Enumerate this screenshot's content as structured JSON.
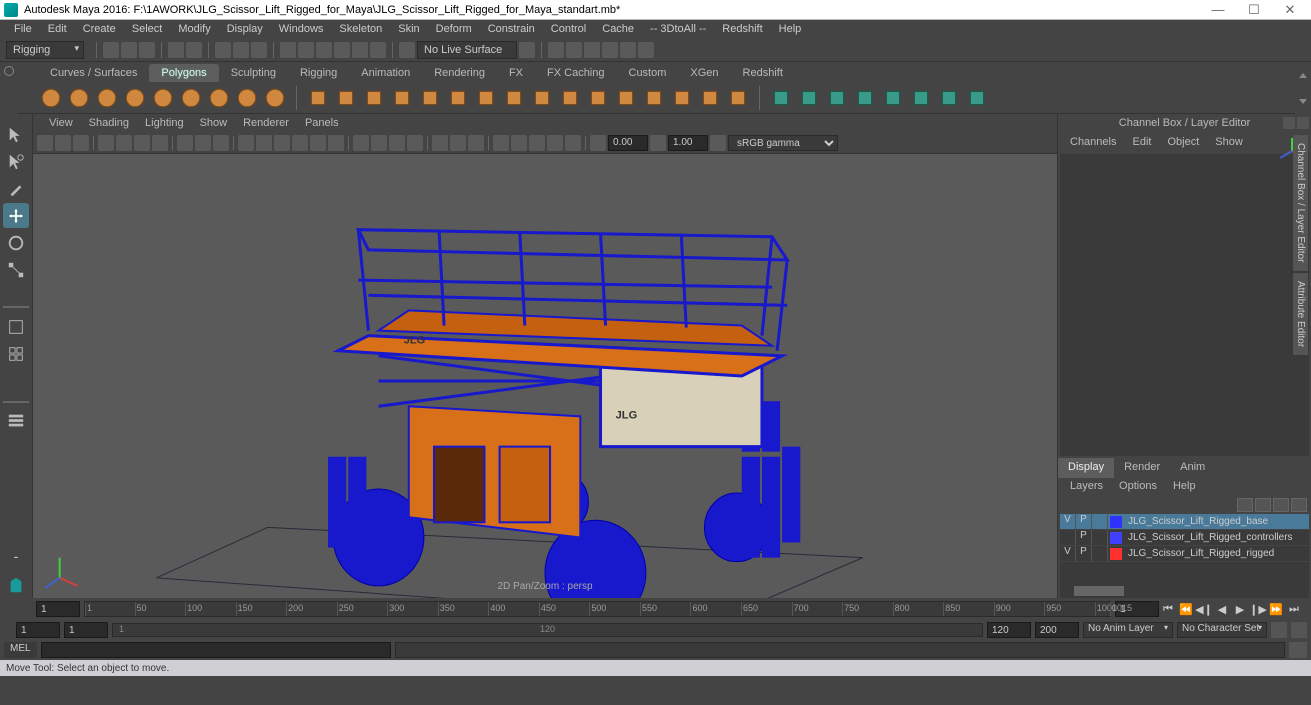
{
  "title": "Autodesk Maya 2016: F:\\1AWORK\\JLG_Scissor_Lift_Rigged_for_Maya\\JLG_Scissor_Lift_Rigged_for_Maya_standart.mb*",
  "menus": [
    "File",
    "Edit",
    "Create",
    "Select",
    "Modify",
    "Display",
    "Windows",
    "Skeleton",
    "Skin",
    "Deform",
    "Constrain",
    "Control",
    "Cache",
    "-- 3DtoAll --",
    "Redshift",
    "Help"
  ],
  "workspace": "Rigging",
  "no_live_surface": "No Live Surface",
  "shelf_tabs": [
    "Curves / Surfaces",
    "Polygons",
    "Sculpting",
    "Rigging",
    "Animation",
    "Rendering",
    "FX",
    "FX Caching",
    "Custom",
    "XGen",
    "Redshift"
  ],
  "shelf_active": "Polygons",
  "panel_menus": [
    "View",
    "Shading",
    "Lighting",
    "Show",
    "Renderer",
    "Panels"
  ],
  "panel_numbers": {
    "a": "0.00",
    "b": "1.00"
  },
  "gamma": "sRGB gamma",
  "scene_label": "2D Pan/Zoom : persp",
  "right_panel": {
    "header": "Channel Box / Layer Editor",
    "menus": [
      "Channels",
      "Edit",
      "Object",
      "Show"
    ]
  },
  "layer": {
    "tabs": [
      "Display",
      "Render",
      "Anim"
    ],
    "tabs_active": "Display",
    "menus": [
      "Layers",
      "Options",
      "Help"
    ],
    "rows": [
      {
        "v": "V",
        "p": "P",
        "r": "",
        "color": "#3030ff",
        "name": "JLG_Scissor_Lift_Rigged_base",
        "selected": true
      },
      {
        "v": "",
        "p": "P",
        "r": "",
        "color": "#4040ff",
        "name": "JLG_Scissor_Lift_Rigged_controllers",
        "selected": false
      },
      {
        "v": "V",
        "p": "P",
        "r": "",
        "color": "#ff3030",
        "name": "JLG_Scissor_Lift_Rigged_rigged",
        "selected": false
      }
    ]
  },
  "side_tabs": [
    "Channel Box / Layer Editor",
    "Attribute Editor"
  ],
  "timeline": {
    "start": "1",
    "current": "1",
    "ticks": [
      1,
      50,
      100,
      150,
      200,
      250,
      300,
      350,
      400,
      450,
      500,
      550,
      600,
      650,
      700,
      750,
      800,
      850,
      900,
      950,
      1000,
      1015
    ],
    "end": "1"
  },
  "range": {
    "a": "1",
    "b": "1",
    "c": "1",
    "mid": "120",
    "d": "120",
    "e": "200",
    "anim_layer": "No Anim Layer",
    "char_set": "No Character Set"
  },
  "cmd_lang": "MEL",
  "help": "Move Tool: Select an object to move."
}
